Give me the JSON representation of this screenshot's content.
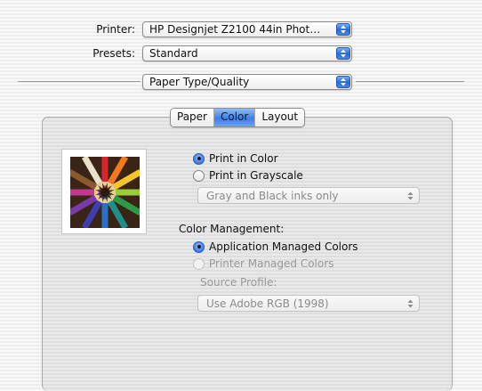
{
  "printer": {
    "label": "Printer:",
    "value": "HP Designjet Z2100 44in Phot…"
  },
  "presets": {
    "label": "Presets:",
    "value": "Standard"
  },
  "panel_select": {
    "value": "Paper Type/Quality"
  },
  "tabs": [
    {
      "label": "Paper",
      "selected": false
    },
    {
      "label": "Color",
      "selected": true
    },
    {
      "label": "Layout",
      "selected": false
    }
  ],
  "preview": {
    "icon": "colored-pencils-image"
  },
  "color_options": {
    "print_in_color": "Print in Color",
    "print_in_grayscale": "Print in Grayscale",
    "gray_popup": "Gray and Black inks only",
    "selected": "print_in_color"
  },
  "color_management": {
    "heading": "Color Management:",
    "app_managed": "Application Managed Colors",
    "printer_managed": "Printer Managed Colors",
    "source_profile_label": "Source Profile:",
    "source_profile_value": "Use Adobe RGB (1998)",
    "selected": "app_managed"
  },
  "colors": {
    "accent": "#3f7ee2",
    "disabled_text": "#9a9a9a"
  }
}
